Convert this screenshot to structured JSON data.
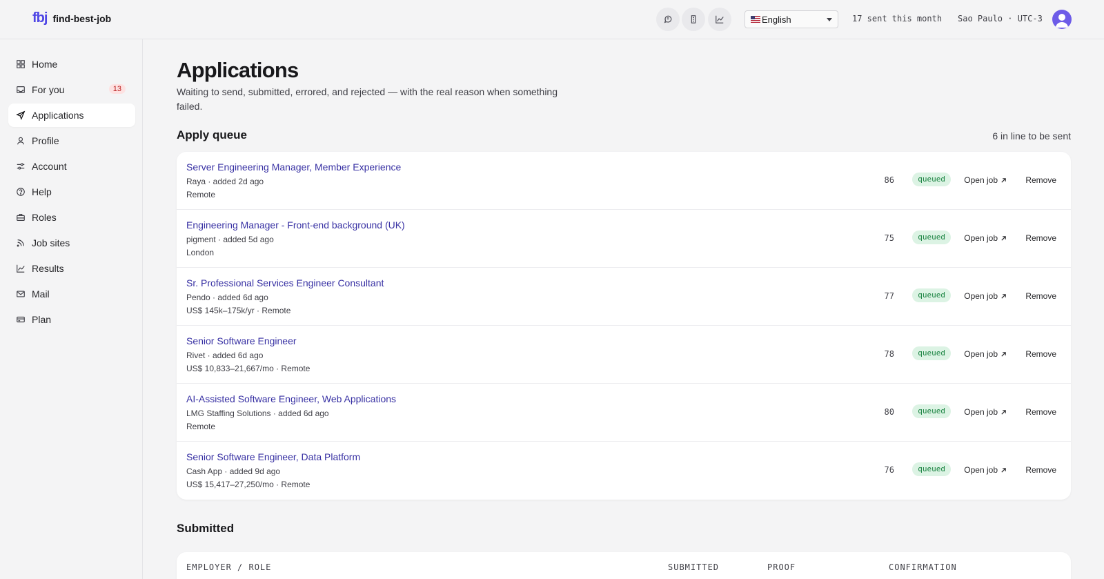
{
  "header": {
    "logo": "fbj",
    "app_name": "find-best-job",
    "icons": [
      "chat-icon",
      "document-icon",
      "chart-icon"
    ],
    "language": "English",
    "sent_this_month": "17 sent this month",
    "timezone": "Sao Paulo · UTC-3"
  },
  "sidebar": {
    "items": [
      {
        "label": "Home",
        "icon": "grid-icon"
      },
      {
        "label": "For you",
        "icon": "inbox-icon",
        "badge": "13"
      },
      {
        "label": "Applications",
        "icon": "send-icon",
        "active": true
      },
      {
        "label": "Profile",
        "icon": "user-icon"
      },
      {
        "label": "Account",
        "icon": "sliders-icon"
      },
      {
        "label": "Help",
        "icon": "help-icon"
      },
      {
        "label": "Roles",
        "icon": "briefcase-icon"
      },
      {
        "label": "Job sites",
        "icon": "rss-icon"
      },
      {
        "label": "Results",
        "icon": "line-chart-icon"
      },
      {
        "label": "Mail",
        "icon": "mail-icon"
      },
      {
        "label": "Plan",
        "icon": "card-icon"
      }
    ]
  },
  "main": {
    "title": "Applications",
    "subtitle": "Waiting to send, submitted, errored, and rejected — with the real reason when something failed.",
    "queue": {
      "title": "Apply queue",
      "count": "6 in line to be sent",
      "open_label": "Open job",
      "remove_label": "Remove",
      "rows": [
        {
          "title": "Server Engineering Manager, Member Experience",
          "meta1": "Raya · added 2d ago",
          "meta2": "Remote",
          "score": "86",
          "status": "queued"
        },
        {
          "title": "Engineering Manager - Front-end background (UK)",
          "meta1": "pigment · added 5d ago",
          "meta2": "London",
          "score": "75",
          "status": "queued"
        },
        {
          "title": "Sr. Professional Services Engineer Consultant",
          "meta1": "Pendo · added 6d ago",
          "meta2": "US$ 145k–175k/yr · Remote",
          "score": "77",
          "status": "queued"
        },
        {
          "title": "Senior Software Engineer",
          "meta1": "Rivet · added 6d ago",
          "meta2": "US$ 10,833–21,667/mo · Remote",
          "score": "78",
          "status": "queued"
        },
        {
          "title": "AI-Assisted Software Engineer, Web Applications",
          "meta1": "LMG Staffing Solutions · added 6d ago",
          "meta2": "Remote",
          "score": "80",
          "status": "queued"
        },
        {
          "title": "Senior Software Engineer, Data Platform",
          "meta1": "Cash App · added 9d ago",
          "meta2": "US$ 15,417–27,250/mo · Remote",
          "score": "76",
          "status": "queued"
        }
      ]
    },
    "submitted": {
      "title": "Submitted",
      "columns": [
        "EMPLOYER / ROLE",
        "SUBMITTED",
        "PROOF",
        "CONFIRMATION"
      ]
    }
  }
}
